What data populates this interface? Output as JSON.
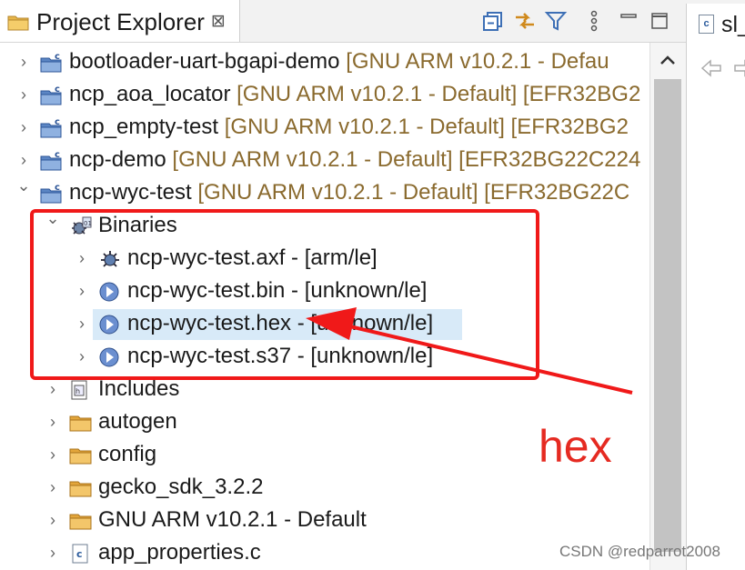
{
  "view": {
    "title": "Project Explorer",
    "close_glyph": "⊠",
    "toolbar": [
      "collapse-all-icon",
      "link-with-editor-icon",
      "filter-icon",
      "view-menu-icon",
      "minimize-icon",
      "maximize-icon"
    ]
  },
  "editor_tab": {
    "label": "sl_",
    "file_icon_letter": "c"
  },
  "tree": [
    {
      "name": "bootloader-uart-bgapi-demo",
      "decoration": "[GNU ARM v10.2.1 - Defau",
      "icon": "project-icon",
      "twisty": "collapsed"
    },
    {
      "name": "ncp_aoa_locator",
      "decoration": "[GNU ARM v10.2.1 - Default] [EFR32BG2",
      "icon": "project-icon",
      "twisty": "collapsed"
    },
    {
      "name": "ncp_empty-test",
      "decoration": "[GNU ARM v10.2.1 - Default] [EFR32BG2",
      "icon": "project-icon",
      "twisty": "collapsed"
    },
    {
      "name": "ncp-demo",
      "decoration": "[GNU ARM v10.2.1 - Default] [EFR32BG22C224",
      "icon": "project-icon",
      "twisty": "collapsed"
    },
    {
      "name": "ncp-wyc-test",
      "decoration": "[GNU ARM v10.2.1 - Default] [EFR32BG22C",
      "icon": "project-icon",
      "twisty": "expanded"
    },
    {
      "name": "Binaries",
      "decoration": "",
      "icon": "binaries-icon",
      "twisty": "expanded"
    },
    {
      "name": "ncp-wyc-test.axf - [arm/le]",
      "decoration": "",
      "icon": "bug-binary-icon",
      "twisty": "collapsed"
    },
    {
      "name": "ncp-wyc-test.bin - [unknown/le]",
      "decoration": "",
      "icon": "binary-file-icon",
      "twisty": "collapsed"
    },
    {
      "name": "ncp-wyc-test.hex - [unknown/le]",
      "decoration": "",
      "icon": "binary-file-icon",
      "twisty": "collapsed",
      "selected": true
    },
    {
      "name": "ncp-wyc-test.s37 - [unknown/le]",
      "decoration": "",
      "icon": "binary-file-icon",
      "twisty": "collapsed"
    },
    {
      "name": "Includes",
      "decoration": "",
      "icon": "includes-icon",
      "twisty": "collapsed"
    },
    {
      "name": "autogen",
      "decoration": "",
      "icon": "folder-icon",
      "twisty": "collapsed"
    },
    {
      "name": "config",
      "decoration": "",
      "icon": "folder-icon",
      "twisty": "collapsed"
    },
    {
      "name": "gecko_sdk_3.2.2",
      "decoration": "",
      "icon": "folder-icon",
      "twisty": "collapsed"
    },
    {
      "name": "GNU ARM v10.2.1 - Default",
      "decoration": "",
      "icon": "folder-icon",
      "twisty": "collapsed"
    },
    {
      "name": "app_properties.c",
      "decoration": "",
      "icon": "c-file-icon",
      "twisty": "collapsed"
    }
  ],
  "annotation": {
    "label": "hex",
    "color": "#e52a21"
  },
  "watermark": "CSDN @redparrot2008",
  "colors": {
    "selection": "#d8eaf8",
    "decoration_text": "#8a6a2e",
    "annotation_red": "#f01919"
  }
}
